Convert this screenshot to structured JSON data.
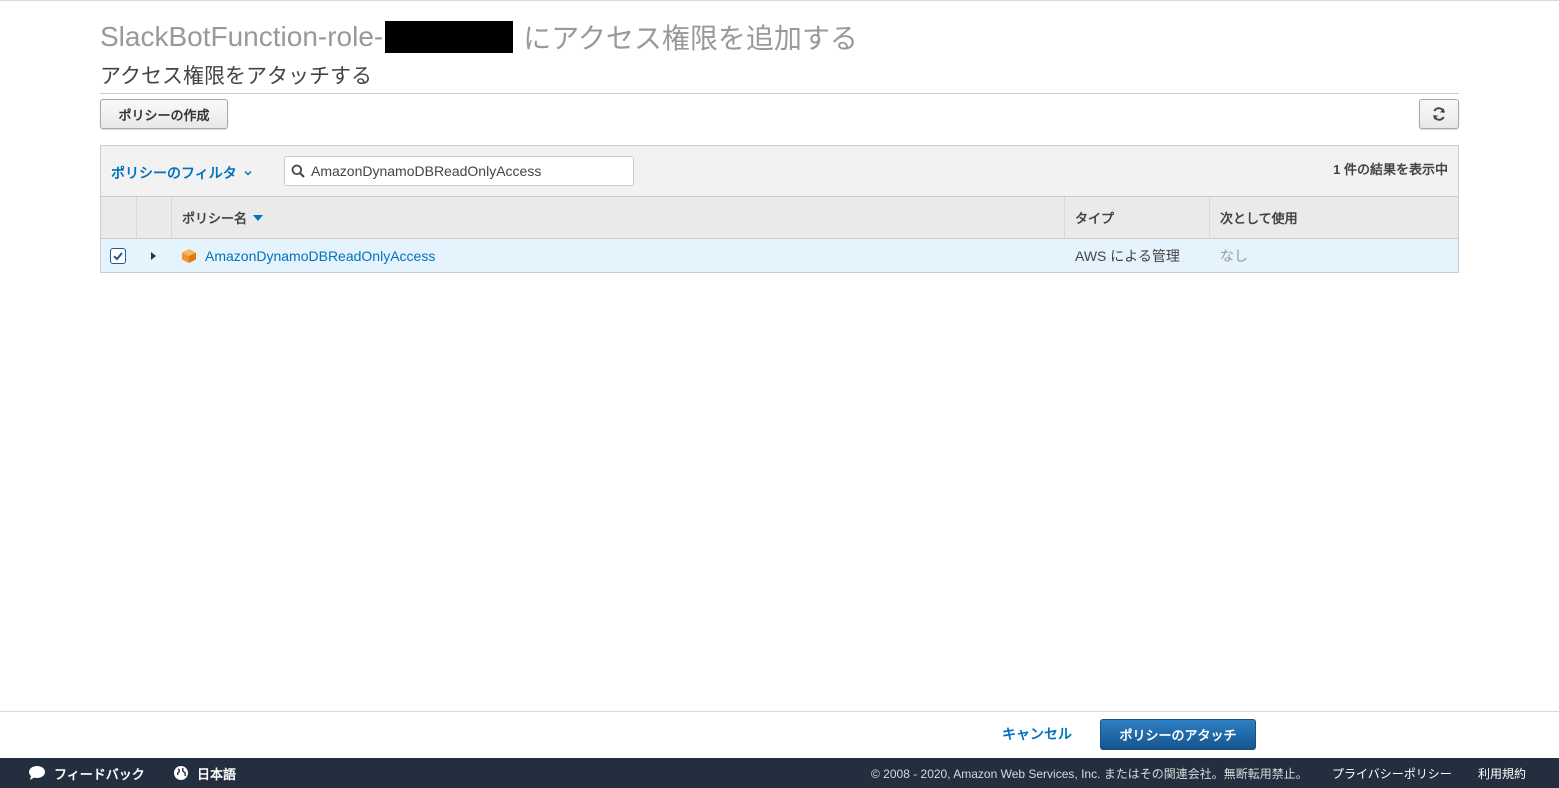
{
  "header": {
    "title_prefix": "SlackBotFunction-role-",
    "title_suffix": "にアクセス権限を追加する",
    "subtitle": "アクセス権限をアタッチする"
  },
  "toolbar": {
    "create_policy_label": "ポリシーの作成",
    "refresh_icon": "refresh-icon"
  },
  "filter": {
    "label": "ポリシーのフィルタ",
    "search_value": "AmazonDynamoDBReadOnlyAccess",
    "result_count": "1 件の結果を表示中"
  },
  "table": {
    "columns": [
      "ポリシー名",
      "タイプ",
      "次として使用"
    ],
    "rows": [
      {
        "checked": true,
        "name": "AmazonDynamoDBReadOnlyAccess",
        "type": "AWS による管理",
        "used_as": "なし"
      }
    ]
  },
  "actions": {
    "cancel_label": "キャンセル",
    "attach_label": "ポリシーのアタッチ"
  },
  "footer": {
    "feedback_label": "フィードバック",
    "language_label": "日本語",
    "copyright": "© 2008 - 2020, Amazon Web Services, Inc. またはその関連会社。無断転用禁止。",
    "privacy_label": "プライバシーポリシー",
    "terms_label": "利用規約"
  },
  "colors": {
    "link": "#0073bb",
    "primary_button": "#15558f",
    "selected_row": "#e5f3fc",
    "bottom_bar": "#232f3e",
    "policy_icon": "#f0932b"
  }
}
